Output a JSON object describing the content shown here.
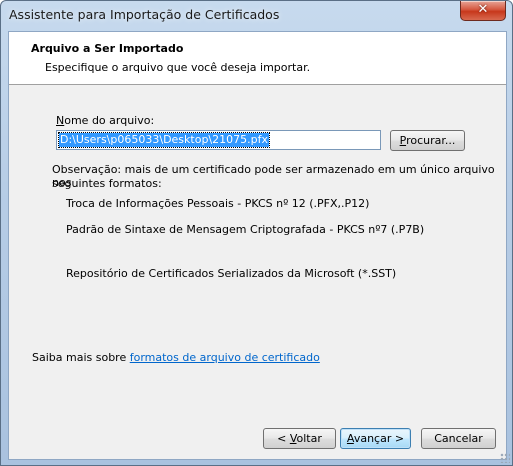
{
  "window": {
    "title": "Assistente para Importação de Certificados",
    "close_glyph": "✕"
  },
  "header": {
    "title": "Arquivo a Ser Importado",
    "subtitle": "Especifique o arquivo que você deseja importar."
  },
  "form": {
    "filename_label_prefix": "N",
    "filename_label_rest": "ome do arquivo:",
    "filename_value": "D:\\Users\\p065033\\Desktop\\21075.pfx",
    "browse_button_prefix": "P",
    "browse_button_rest": "rocurar...",
    "note_line1": "Observação: mais de um certificado pode ser armazenado em um único arquivo nos",
    "note_line2": "seguintes formatos:",
    "formats": [
      "Troca de Informações Pessoais - PKCS nº 12 (.PFX,.P12)",
      "Padrão de Sintaxe de Mensagem Criptografada - PKCS nº7 (.P7B)",
      "Repositório de Certificados Serializados da Microsoft (*.SST)"
    ]
  },
  "learn_more": {
    "prefix": "Saiba mais sobre ",
    "link": "formatos de arquivo de certificado"
  },
  "buttons": {
    "back_prefix": "< ",
    "back_key": "V",
    "back_rest": "oltar",
    "next_key": "A",
    "next_rest": "vançar >",
    "cancel": "Cancelar"
  }
}
